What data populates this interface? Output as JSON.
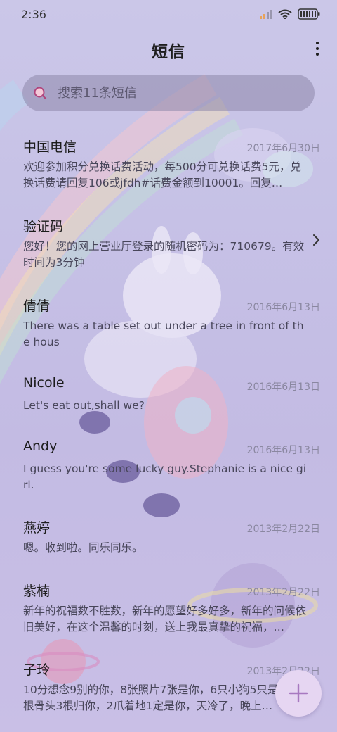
{
  "status_bar": {
    "time": "2:36",
    "icons": [
      "signal-icon",
      "wifi-icon",
      "battery-icon"
    ]
  },
  "header": {
    "title": "短信",
    "more_icon": "more-vertical-icon"
  },
  "search": {
    "placeholder": "搜索11条短信",
    "icon": "search-icon"
  },
  "messages": [
    {
      "sender": "中国电信",
      "date": "2017年6月30日",
      "preview": "欢迎参加积分兑换话费活动，每500分可兑换话费5元，兑换话费请回复106或jfdh#话费金额到10001。回复…"
    },
    {
      "sender": "验证码",
      "date": "",
      "preview": "您好！您的网上营业厅登录的随机密码为：710679。有效时间为3分钟"
    },
    {
      "sender": "倩倩",
      "date": "2016年6月13日",
      "preview": "There was a table set out under a tree in front of the hous"
    },
    {
      "sender": "Nicole",
      "date": "2016年6月13日",
      "preview": "Let's eat out,shall we?"
    },
    {
      "sender": "Andy",
      "date": "2016年6月13日",
      "preview": "I guess you're some lucky guy.Stephanie is a nice girl."
    },
    {
      "sender": "燕婷",
      "date": "2013年2月22日",
      "preview": "嗯。收到啦。同乐同乐。"
    },
    {
      "sender": "紫楠",
      "date": "2013年2月22日",
      "preview": "新年的祝福数不胜数，新年的愿望好多好多，新年的问候依旧美好，在这个温馨的时刻，送上我最真挚的祝福，…"
    },
    {
      "sender": "子玲",
      "date": "2013年2月22日",
      "preview": "10分想念9别的你，8张照片7张是你，6只小狗5只是你，4根骨头3根归你，2爪着地1定是你，天冷了，晚上…"
    }
  ],
  "fab": {
    "icon": "plus-icon"
  },
  "colors": {
    "background": "#c6c1e6",
    "search_bg": "#8c86aa",
    "fab_bg": "#e6d6f2",
    "fab_plus": "#a779c0",
    "date_text": "#8a87a0"
  }
}
